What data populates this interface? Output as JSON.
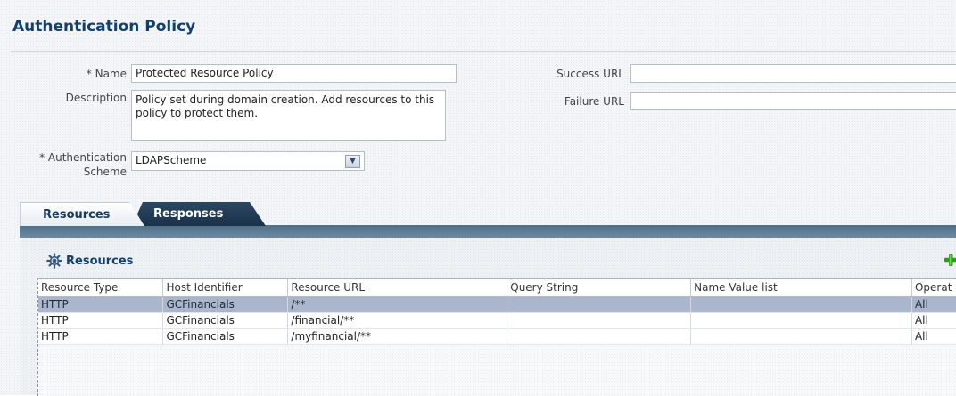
{
  "page": {
    "title": "Authentication Policy"
  },
  "form": {
    "name_label": "* Name",
    "name_value": "Protected Resource Policy",
    "description_label": "Description",
    "description_value": "Policy set during domain creation. Add resources to this policy to protect them.",
    "auth_scheme_label_line1": "* Authentication",
    "auth_scheme_label_line2": "Scheme",
    "auth_scheme_value": "LDAPScheme",
    "success_url_label": "Success URL",
    "success_url_value": "",
    "failure_url_label": "Failure URL",
    "failure_url_value": ""
  },
  "tabs": [
    {
      "label": "Resources",
      "active": true
    },
    {
      "label": "Responses",
      "active": false
    }
  ],
  "resources_panel": {
    "title": "Resources",
    "icons": {
      "panel": "gear-icon",
      "add": "add-icon"
    },
    "columns": [
      "Resource Type",
      "Host Identifier",
      "Resource URL",
      "Query String",
      "Name Value list",
      "Operat"
    ],
    "rows": [
      [
        "HTTP",
        "GCFinancials",
        "/**",
        "",
        "",
        "All"
      ],
      [
        "HTTP",
        "GCFinancials",
        "/financial/**",
        "",
        "",
        "All"
      ],
      [
        "HTTP",
        "GCFinancials",
        "/myfinancial/**",
        "",
        "",
        "All"
      ]
    ],
    "selected_row": 0
  },
  "colors": {
    "title": "#12406e",
    "tab_dark": "#1a324a",
    "selection": "#a9b6cc",
    "add_green": "#2f9a1c"
  }
}
